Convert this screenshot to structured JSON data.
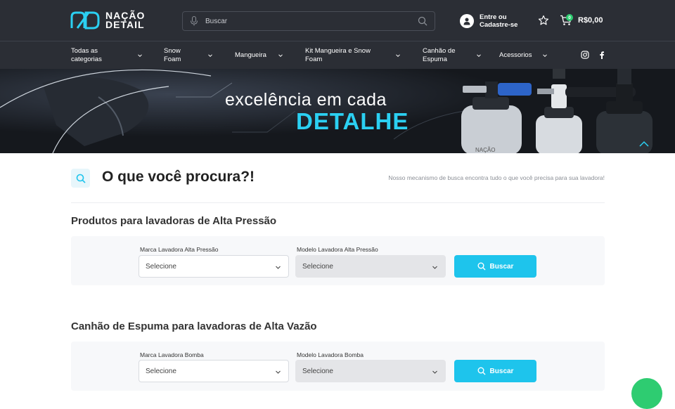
{
  "header": {
    "logo_line1": "NAÇÃO",
    "logo_line2": "DETAIL",
    "search_placeholder": "Buscar",
    "account_line1": "Entre ou",
    "account_line2": "Cadastre-se",
    "cart_count": "0",
    "cart_total": "R$0,00",
    "icons": [
      "logo-icon",
      "mic-icon",
      "search-icon",
      "user-icon",
      "star-icon",
      "cart-icon"
    ]
  },
  "nav": {
    "items": [
      {
        "label": "Todas as categorias"
      },
      {
        "label": "Snow Foam"
      },
      {
        "label": "Mangueira"
      },
      {
        "label": "Kit Mangueira e Snow Foam"
      },
      {
        "label": "Canhão de Espuma"
      },
      {
        "label": "Acessorios"
      }
    ],
    "social": [
      "instagram-icon",
      "facebook-icon"
    ]
  },
  "banner": {
    "line1": "excelência em cada",
    "line2": "DETALHE",
    "bottle_brand": "NAÇÃO"
  },
  "main": {
    "title": "O que você procura?!",
    "subtitle": "Nosso mecanismo de busca encontra tudo o que você precisa para sua lavadora!",
    "sections": [
      {
        "title": "Produtos para lavadoras de Alta Pressão",
        "brand_label": "Marca Lavadora Alta Pressão",
        "brand_value": "Selecione",
        "model_label": "Modelo Lavadora Alta Pressão",
        "model_value": "Selecione",
        "button_label": "Buscar"
      },
      {
        "title": "Canhão de Espuma para lavadoras de Alta Vazão",
        "brand_label": "Marca Lavadora Bomba",
        "brand_value": "Selecione",
        "model_label": "Modelo Lavadora Bomba",
        "model_value": "Selecione",
        "button_label": "Buscar"
      }
    ]
  },
  "colors": {
    "header_bg": "#2b2e35",
    "accent": "#1ec4ec",
    "cart_badge": "#2ecc71"
  }
}
